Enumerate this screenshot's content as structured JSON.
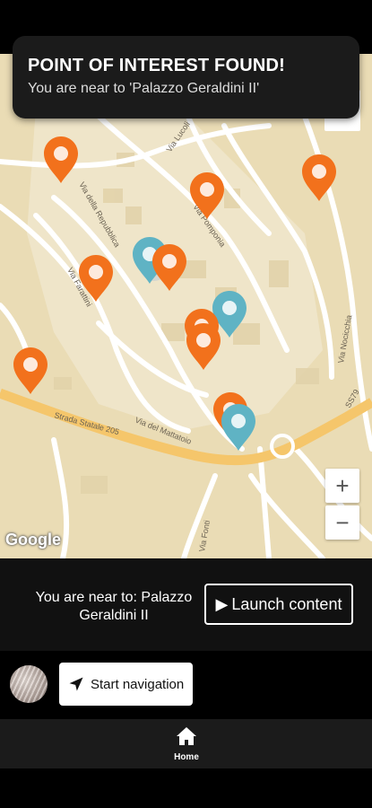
{
  "toast": {
    "title": "POINT OF INTEREST FOUND!",
    "message": "You are near to 'Palazzo Geraldini II'"
  },
  "map": {
    "attribution": "Google",
    "zoom_in": "+",
    "zoom_out": "−",
    "streets": [
      "Via della Repubblica",
      "Via Farattini",
      "Strada Statale 205",
      "Via del Mattatoio",
      "Via Pomponia",
      "Via Nocicchia",
      "Via Fonti",
      "Via Lucoli",
      "SS79"
    ],
    "colors": {
      "poi_orange": "#f2711c",
      "poi_teal": "#5fb3c4",
      "user_location": "#3b82f6",
      "land": "#eadcb5",
      "road_main": "#f5c66b"
    }
  },
  "near_panel": {
    "text": "You are near to: Palazzo Geraldini II",
    "launch_label": "Launch content"
  },
  "navigation": {
    "start_label": "Start navigation"
  },
  "tabs": {
    "home_label": "Home"
  }
}
